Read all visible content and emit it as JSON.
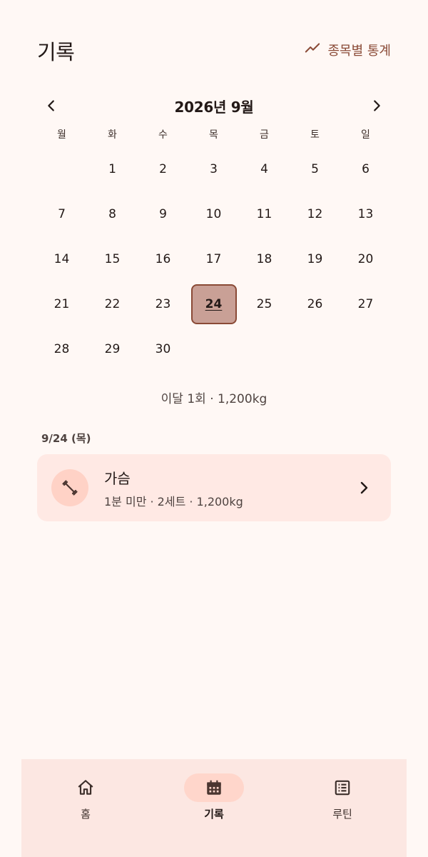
{
  "header": {
    "title": "기록",
    "stats_label": "종목별 통계"
  },
  "calendar": {
    "month_label": "2026년 9월",
    "weekdays": [
      "월",
      "화",
      "수",
      "목",
      "금",
      "토",
      "일"
    ],
    "leading_blanks": 1,
    "days_in_month": 30,
    "selected_day": 24
  },
  "summary": {
    "text": "이달 1회 · 1,200kg"
  },
  "selected_date": {
    "heading": "9/24 (목)"
  },
  "workouts": [
    {
      "title": "가슴",
      "subtitle": "1분 미만 · 2세트 · 1,200kg",
      "icon": "dumbbell-icon"
    }
  ],
  "bottom_nav": {
    "items": [
      {
        "label": "홈",
        "icon": "home-icon",
        "active": false
      },
      {
        "label": "기록",
        "icon": "calendar-icon",
        "active": true
      },
      {
        "label": "루틴",
        "icon": "list-icon",
        "active": false
      }
    ]
  },
  "colors": {
    "accent": "#8a4a36",
    "background": "#fff8f5",
    "card": "#ffe9e4",
    "selected_day_fill": "#c9a096",
    "nav_background": "#fce7e2"
  }
}
